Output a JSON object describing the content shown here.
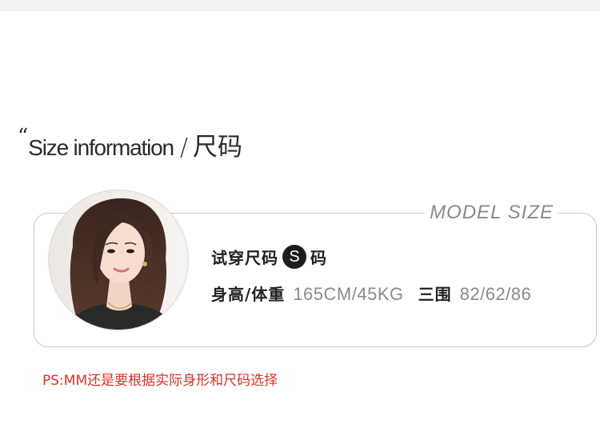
{
  "heading": {
    "quote_mark": "“",
    "english": "Size information",
    "separator": "/",
    "chinese": "尺码"
  },
  "card": {
    "label": "MODEL SIZE",
    "trial": {
      "label": "试穿尺码",
      "size": "S",
      "suffix": "码"
    },
    "stats": {
      "height_weight_label": "身高/体重",
      "height_weight_value": "165CM/45KG",
      "measurements_label": "三围",
      "measurements_value": "82/62/86"
    }
  },
  "note": "PS:MM还是要根据实际身形和尺码选择",
  "colors": {
    "note_red": "#e0312c",
    "muted_gray": "#8a8a8a",
    "badge_black": "#1c1c1c",
    "border": "#c9c9c9"
  }
}
